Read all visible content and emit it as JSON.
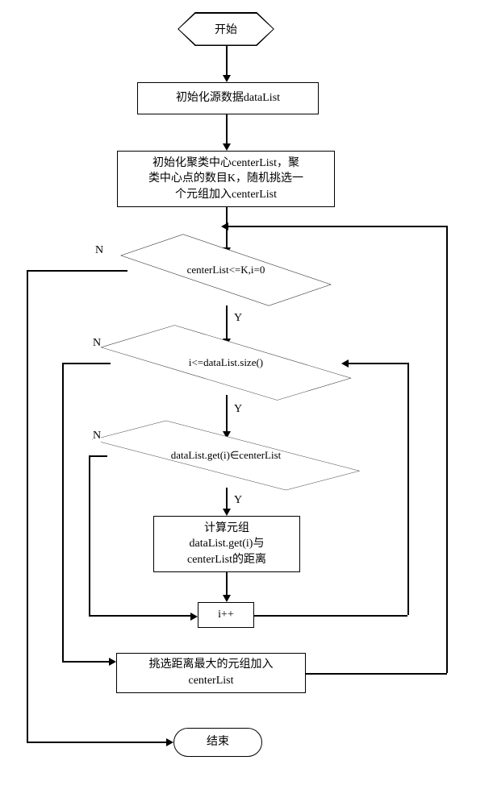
{
  "flow": {
    "start": "开始",
    "init_data": "初始化源数据dataList",
    "init_center": "初始化聚类中心centerList，聚\n类中心点的数目K，随机挑选一\n个元组加入centerList",
    "cond1": "centerList<=K,i=0",
    "cond2": "i<=dataList.size()",
    "cond3": "dataList.get(i)∈centerList",
    "calc": "计算元组\ndataList.get(i)与\ncenterList的距离",
    "incr": "i++",
    "select_max": "挑选距离最大的元组加入\ncenterList",
    "end": "结束"
  },
  "labels": {
    "yes": "Y",
    "no": "N"
  }
}
